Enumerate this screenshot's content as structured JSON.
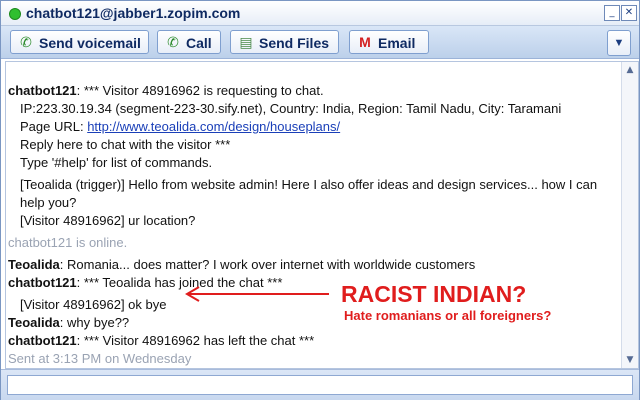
{
  "window": {
    "title": "chatbot121@jabber1.zopim.com",
    "minimize": "_",
    "close": "✕"
  },
  "toolbar": {
    "voicemail_label": "Send voicemail",
    "call_label": "Call",
    "files_label": "Send Files",
    "email_label": "Email"
  },
  "chat": {
    "line1_sender": "chatbot121",
    "line1_text": ": *** Visitor 48916962 is requesting to chat.",
    "line2": "IP:223.30.19.34 (segment-223-30.sify.net), Country: India, Region: Tamil Nadu, City: Taramani",
    "line3_label": "Page URL: ",
    "line3_url": "http://www.teoalida.com/design/houseplans/",
    "line4": "Reply here to chat with the visitor ***",
    "line5": "Type '#help' for list of commands.",
    "line6": "[Teoalida (trigger)] Hello from website admin! Here I also offer ideas and design services... how I can",
    "line7": "help you?",
    "line8": "[Visitor 48916962] ur location?",
    "line9": "chatbot121 is online.",
    "line10_sender": "Teoalida",
    "line10_text": ": Romania... does matter? I work over internet with worldwide customers",
    "line11_sender": "chatbot121",
    "line11_text": ": *** Teoalida has joined the chat ***",
    "line12": "[Visitor 48916962] ok bye",
    "line13_sender": "Teoalida",
    "line13_text": ": why bye??",
    "line14_sender": "chatbot121",
    "line14_text": ": *** Visitor 48916962 has left the chat ***",
    "line15": "Sent at 3:13 PM on Wednesday"
  },
  "annotation": {
    "main": "RACIST INDIAN?",
    "sub": "Hate romanians or all foreigners?"
  }
}
